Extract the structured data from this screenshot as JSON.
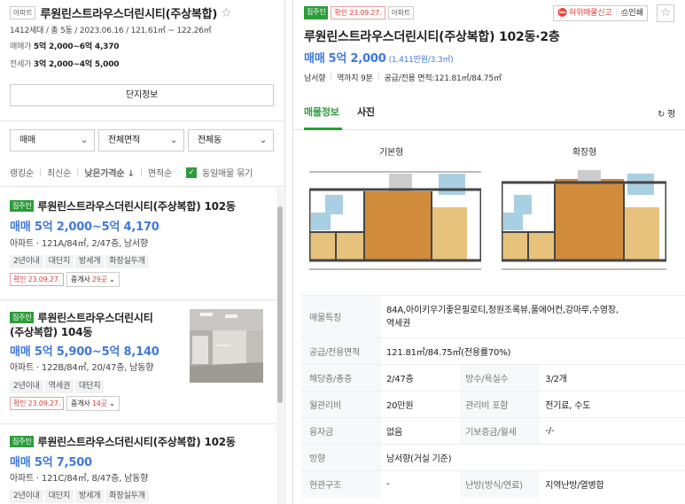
{
  "left": {
    "header": {
      "apt_tag": "아파트",
      "title": "루원린스트라우스더린시티(주상복합)",
      "meta": "1412세대 / 총 5동 / 2023.06.16 / 121.61㎡ ~ 122.26㎡",
      "sale_label": "매매가",
      "sale_value": "5억 2,000~6억 4,370",
      "rent_label": "전세가",
      "rent_value": "3억 2,000~4억 5,000",
      "complex_info_btn": "단지정보"
    },
    "filters": [
      {
        "label": "매매"
      },
      {
        "label": "전체면적"
      },
      {
        "label": "전체동"
      }
    ],
    "sort": {
      "ranking": "랭킹순",
      "latest": "최신순",
      "low_price": "낮은가격순",
      "low_price_arrow": "↓",
      "area": "면적순",
      "same_group": "동일매물 묶기"
    },
    "listings": [
      {
        "verify_tag": "집주인",
        "title": "루원린스트라우스더린시티(주상복합) 102동",
        "price": "매매 5억 2,000~5억 4,170",
        "detail": "아파트 · 121A/84㎡, 2/47층, 남서향",
        "chips": [
          "2년이내",
          "대단지",
          "방세개",
          "화장실두개"
        ],
        "confirm": "확인 23.09.27.",
        "broker_label": "중개사",
        "broker_count": "29곳"
      },
      {
        "verify_tag": "집주인",
        "title1": "루원린스트라우스더린시티",
        "title2": "(주상복합) 104동",
        "price": "매매 5억 5,900~5억 8,140",
        "detail": "아파트 · 122B/84㎡, 20/47층, 남동향",
        "chips": [
          "2년이내",
          "역세권",
          "대단지"
        ],
        "confirm": "확인 23.09.27.",
        "broker_label": "중개사",
        "broker_count": "14곳"
      },
      {
        "verify_tag": "집주인",
        "title": "루원린스트라우스더린시티(주상복합) 102동",
        "price": "매매 5억 7,500",
        "detail": "아파트 · 121C/84㎡, 8/47층, 남동향",
        "chips": [
          "2년이내",
          "대단지",
          "방세개",
          "화장실두개"
        ]
      }
    ]
  },
  "right": {
    "owner_tag": "집주인",
    "confirm_tag": "확인 23.09.27.",
    "apt_tag": "아파트",
    "report_btn": "허위매물신고",
    "print_btn": "인쇄",
    "title": "루원린스트라우스더린시티(주상복합) 102동·2층",
    "price_label": "매매",
    "price_value": "5억 2,000",
    "price_per": "(1,411만원/3.3㎡)",
    "summary": [
      "남서향",
      "역까지 9분",
      "공급/전용 면적:121.81㎡/84.75㎡"
    ],
    "tabs": [
      "매물정보",
      "사진"
    ],
    "tab_right": "평",
    "floorplans": [
      "기본형",
      "확장형"
    ],
    "info_rows": {
      "features_label": "매물특징",
      "features_value1": "84A,아이키우기좋은필로티,정원조록뷰,풀에어컨,강마루,수영장,",
      "features_value2": "역세권",
      "area_label": "공급/전용면적",
      "area_value": "121.81㎡/84.75㎡(전용률70%)",
      "floor_label": "해당층/총층",
      "floor_value": "2/47층",
      "rooms_label": "방수/욕실수",
      "rooms_value": "3/2개",
      "fee_label": "월관리비",
      "fee_value": "20만원",
      "fee_incl_label": "관리비 포함",
      "fee_incl_value": "전기료, 수도",
      "loan_label": "융자금",
      "loan_value": "없음",
      "deposit_label": "기보증금/월세",
      "deposit_value": "-/-",
      "dir_label": "방향",
      "dir_value": "남서향(거실 기준)",
      "entrance_label": "현관구조",
      "entrance_value": "-",
      "heating_label": "난방(방식/연료)",
      "heating_value": "지역난방/열병합"
    }
  }
}
